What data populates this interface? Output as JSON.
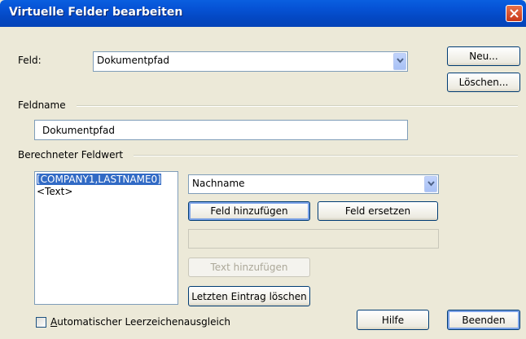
{
  "window": {
    "title": "Virtuelle Felder bearbeiten"
  },
  "feld": {
    "label": "Feld:",
    "selected": "Dokumentpfad"
  },
  "buttons": {
    "neu": "Neu...",
    "loeschen": "Löschen...",
    "feld_hinzufuegen": "Feld hinzufügen",
    "feld_ersetzen": "Feld ersetzen",
    "text_hinzufuegen": "Text hinzufügen",
    "letzten_loeschen": "Letzten Eintrag löschen",
    "hilfe": "Hilfe",
    "beenden": "Beenden"
  },
  "feldname": {
    "group_label": "Feldname",
    "value": "Dokumentpfad"
  },
  "berechnet": {
    "group_label": "Berechneter Feldwert",
    "items": [
      "[COMPANY1,LASTNAME0]",
      "<Text>"
    ],
    "selected_index": 0,
    "field_combo": "Nachname",
    "text_value": ""
  },
  "checkbox": {
    "label_prefix": "A",
    "label_rest": "utomatischer Leerzeichenausgleich",
    "checked": false
  },
  "colors": {
    "titlebar": "#0653d6",
    "selection": "#316ac5",
    "background": "#ece9d8"
  }
}
